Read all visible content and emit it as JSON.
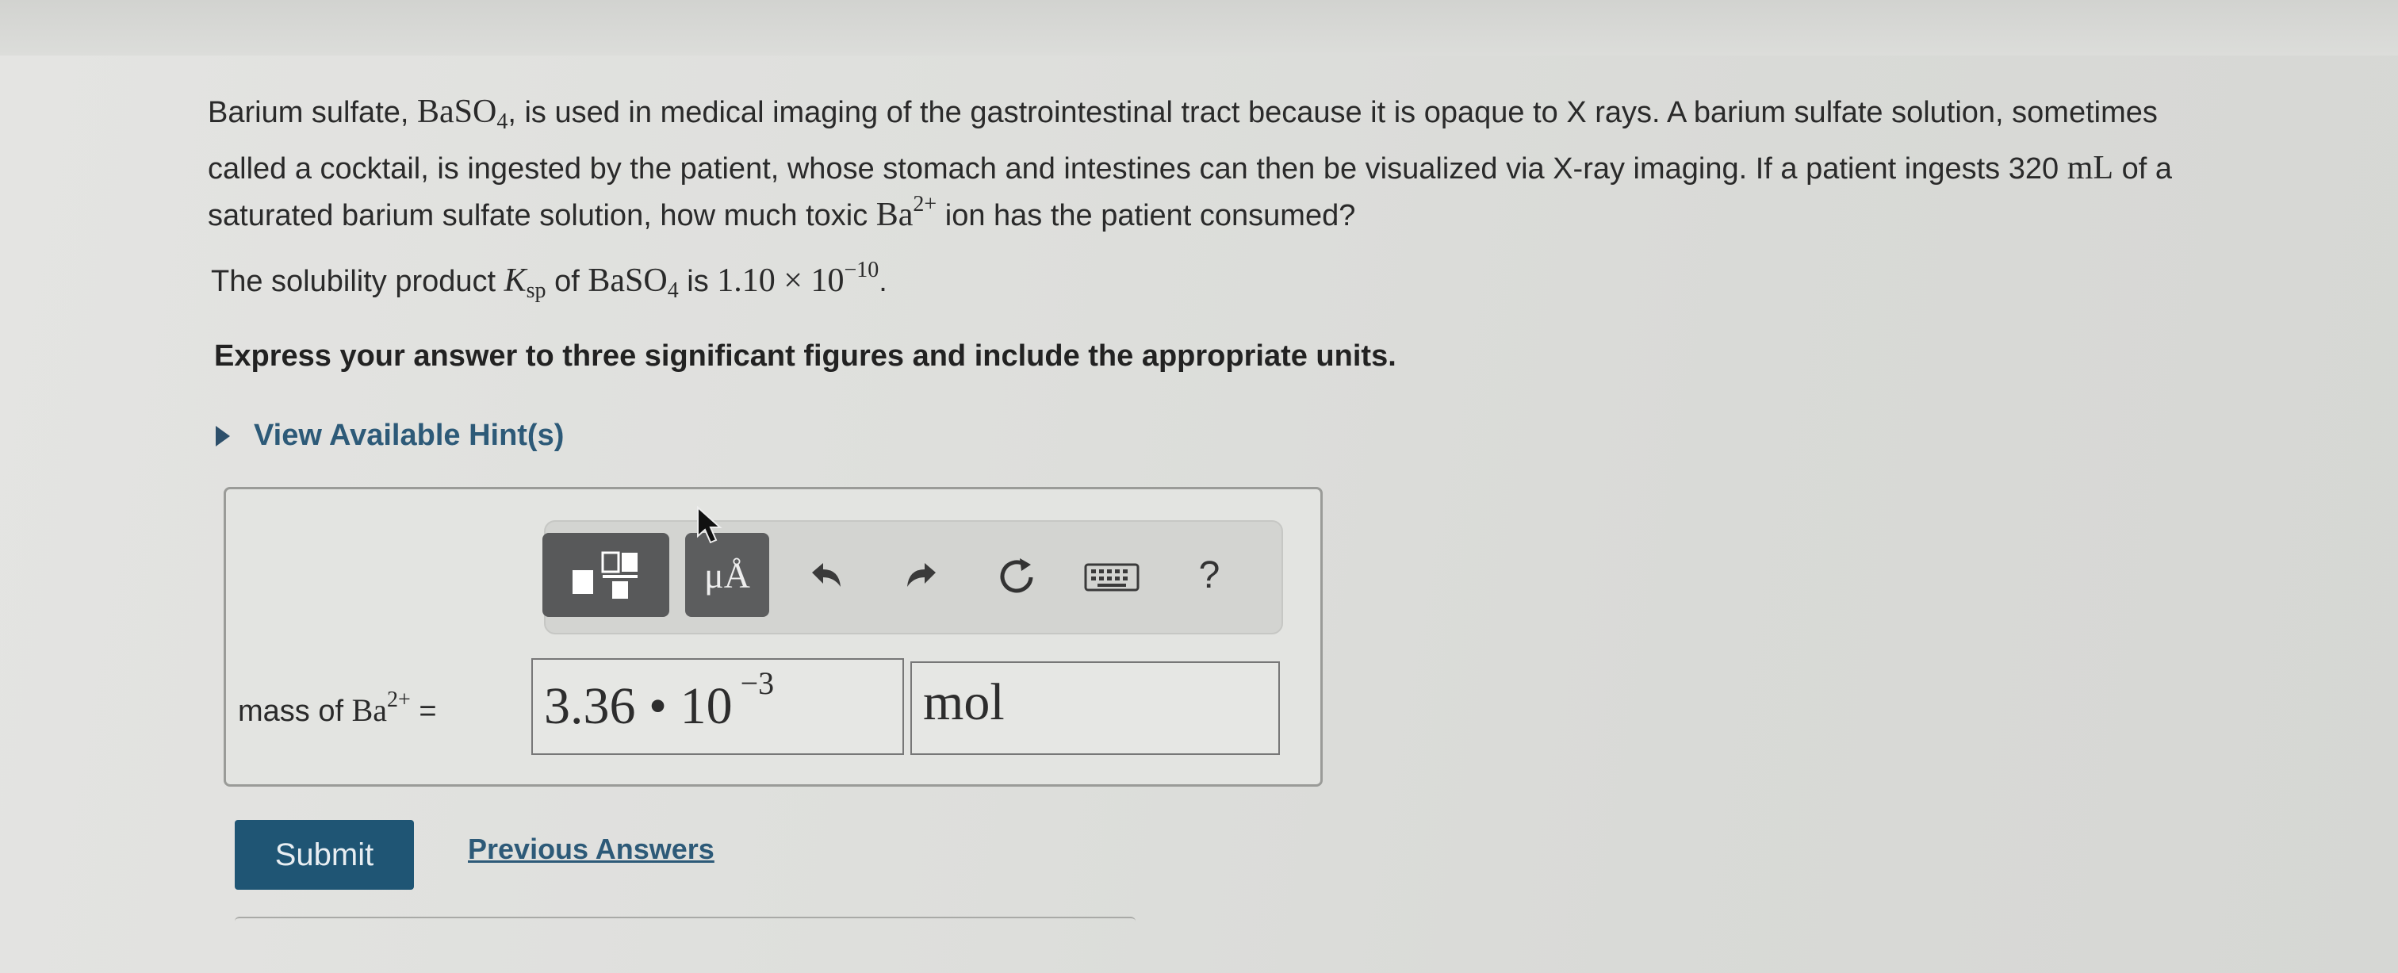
{
  "problem": {
    "p1": "Barium sulfate, ",
    "compound_base": "BaSO",
    "compound_sub": "4",
    "p2": ", is used in medical imaging of the gastrointestinal tract because it is opaque to X rays. A barium sulfate solution, sometimes called a cocktail, is ingested by the patient, whose stomach and intestines can then be visualized via X-ray imaging. If a patient ingests 320 ",
    "volume_unit": "mL",
    "p3": " of a saturated barium sulfate solution, how much toxic ",
    "ion_base": "Ba",
    "ion_sup": "2+",
    "p4": " ion has the patient consumed?"
  },
  "ksp": {
    "prefix": "The solubility product ",
    "k_symbol": "K",
    "k_sub": "sp",
    "middle": " of ",
    "compound_base": "BaSO",
    "compound_sub": "4",
    "is": " is ",
    "value": "1.10 × 10",
    "exponent": "−10",
    "end": "."
  },
  "instructions": "Express your answer to three significant figures and include the appropriate units.",
  "hint_label": "View Available Hint(s)",
  "toolbar": {
    "units_label": "μÅ",
    "help_label": "?"
  },
  "answer": {
    "label_prefix": "mass of ",
    "ion_base": "Ba",
    "ion_sup": "2+",
    "equals": " =",
    "value_mantissa": "3.36 • 10",
    "value_exponent": "−3",
    "unit": "mol"
  },
  "submit_label": "Submit",
  "previous_answers_label": "Previous Answers",
  "colors": {
    "accent": "#2d5a78",
    "submit_bg": "#1f5574"
  }
}
